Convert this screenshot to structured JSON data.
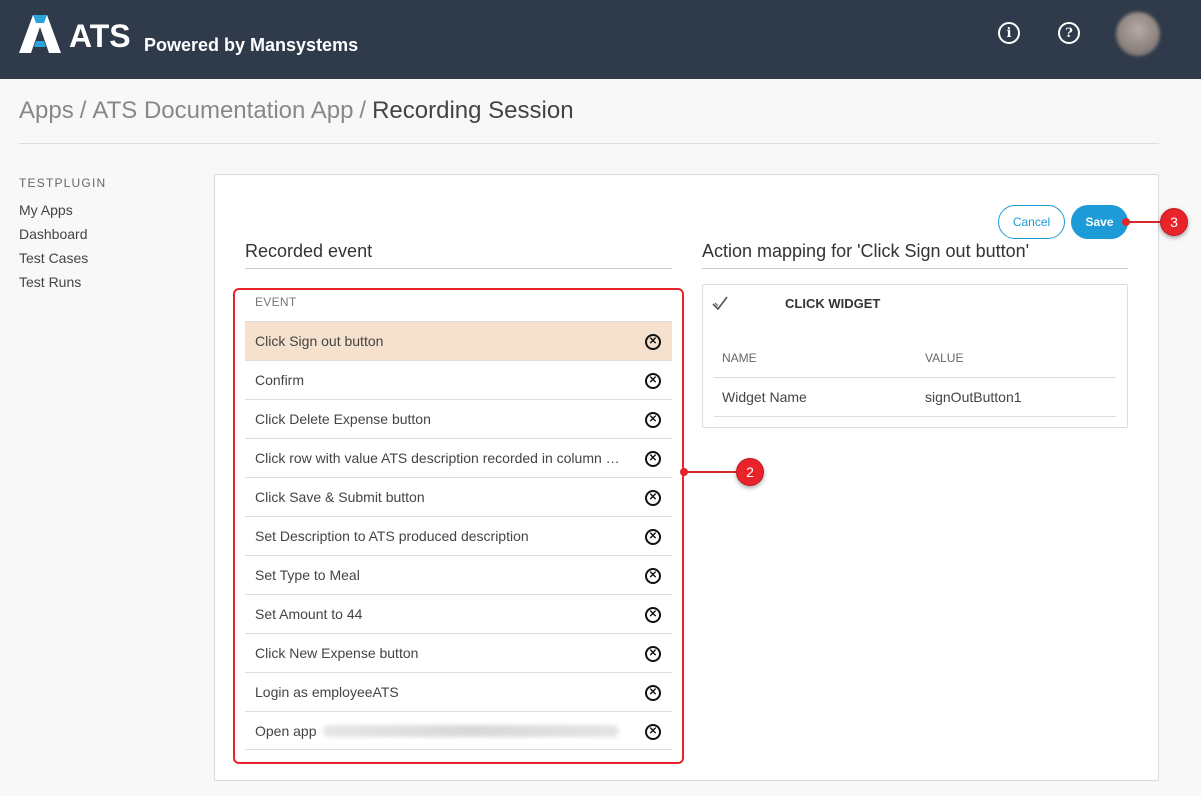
{
  "header": {
    "brand": "ATS",
    "tagline": "Powered by Mansystems",
    "info_icon": "i",
    "help_icon": "?"
  },
  "breadcrumb": {
    "items": [
      "Apps",
      "ATS Documentation App",
      "Recording Session"
    ],
    "separator": "/"
  },
  "sidebar": {
    "title": "TESTPLUGIN",
    "items": [
      {
        "label": "My Apps"
      },
      {
        "label": "Dashboard"
      },
      {
        "label": "Test Cases"
      },
      {
        "label": "Test Runs"
      }
    ]
  },
  "actions": {
    "cancel_label": "Cancel",
    "save_label": "Save"
  },
  "recorded_event": {
    "title": "Recorded event",
    "column_header": "EVENT",
    "events": [
      {
        "label": "Click Sign out button",
        "selected": true
      },
      {
        "label": "Confirm"
      },
      {
        "label": "Click Delete Expense button"
      },
      {
        "label": "Click row with value ATS description recorded in column colu..."
      },
      {
        "label": "Click Save & Submit button"
      },
      {
        "label": "Set Description to ATS produced description"
      },
      {
        "label": "Set Type to Meal"
      },
      {
        "label": "Set Amount to 44"
      },
      {
        "label": "Click New Expense button"
      },
      {
        "label": "Login as employeeATS"
      },
      {
        "label": "Open app"
      }
    ]
  },
  "action_mapping": {
    "title": "Action mapping for 'Click Sign out button'",
    "type": "CLICK WIDGET",
    "columns": {
      "name": "NAME",
      "value": "VALUE"
    },
    "rows": [
      {
        "name": "Widget Name",
        "value": "signOutButton1"
      }
    ]
  },
  "annotations": {
    "badge_2": "2",
    "badge_3": "3",
    "color": "#e8242a"
  },
  "colors": {
    "topbar": "#2f3b4a",
    "accent": "#1d9bd7",
    "selected_row": "#f5e1cd"
  }
}
